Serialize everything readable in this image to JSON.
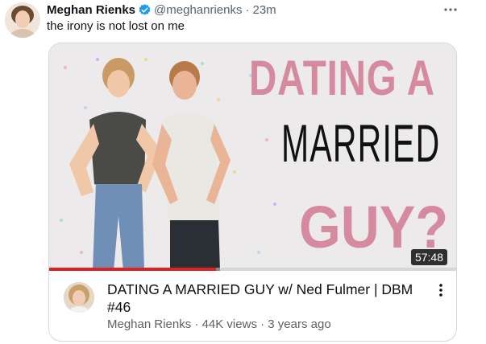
{
  "tweet": {
    "author_name": "Meghan Rienks",
    "handle": "@meghanrienks",
    "separator": "·",
    "time": "23m",
    "text": "the irony is not lost on me",
    "more_icon": "more-horizontal-icon",
    "verified_icon": "verified-badge-icon",
    "verified_color": "#1d9bf0"
  },
  "video": {
    "thumbnail_text": {
      "line1": "DATING A",
      "line2": "MARRIED",
      "line3": "GUY?"
    },
    "thumbnail_accent": "#d58aa0",
    "duration": "57:48",
    "progress_fraction": 0.41,
    "progress_color": "#e02121",
    "title": "DATING A MARRIED GUY w/ Ned Fulmer  |  DBM #46",
    "channel": "Meghan Rienks",
    "views": "44K views",
    "age": "3 years ago",
    "meta_separator": "·",
    "menu_icon": "more-vertical-icon"
  }
}
